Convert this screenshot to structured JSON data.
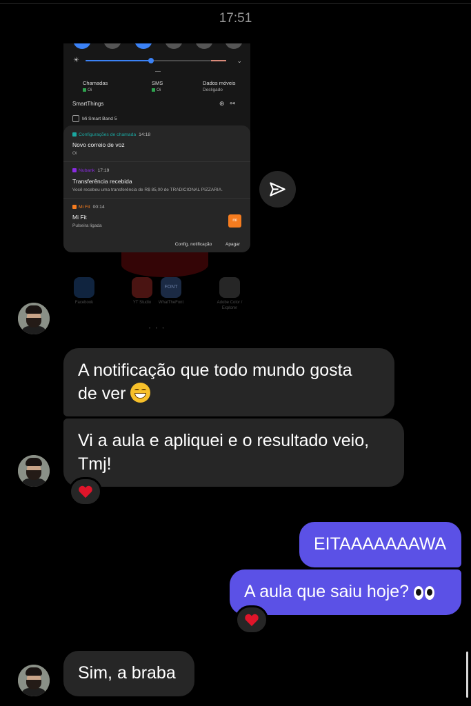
{
  "header": {
    "time": "17:51"
  },
  "shared_screenshot": {
    "quick_settings": {
      "sims": [
        {
          "label": "Chamadas",
          "value": "Oi"
        },
        {
          "label": "SMS",
          "value": "Oi"
        },
        {
          "label": "Dados móveis",
          "value": "Desligado"
        }
      ],
      "smartthings_label": "SmartThings",
      "device_label": "Mi Smart Band 5",
      "brightness_level": 0.52
    },
    "notifications": [
      {
        "app": "Configurações de chamada",
        "time": "14:18",
        "title": "Novo correio de voz",
        "body": "Oi",
        "icon_color": "#1aa7a0"
      },
      {
        "app": "Nubank",
        "time": "17:19",
        "title": "Transferência recebida",
        "body": "Você recebeu uma transferência de R$ 85,00 de TRADICIONAL PIZZARIA.",
        "icon_color": "#8a2be2"
      },
      {
        "app": "Mi Fit",
        "time": "00:14",
        "title": "Mi Fit",
        "body": "Pulseira ligada",
        "icon_color": "#f57c1f",
        "thumb_text": "mi"
      }
    ],
    "notification_actions": {
      "settings": "Config. notificação",
      "clear": "Apagar"
    },
    "home_apps": [
      {
        "label": "Facebook",
        "color": "#1877f2"
      },
      {
        "label": "YT Studio",
        "color": "#e5271d"
      },
      {
        "label": "WhatTheFont",
        "color": "#2c4b8a",
        "icon_text": "FONT"
      },
      {
        "label": "Adobe Color / Explorer",
        "color": "#3a3a3a"
      }
    ]
  },
  "messages": [
    {
      "from": "them",
      "text": "A notificação que todo mundo gosta",
      "text2": "de ver",
      "emoji": "grinning-face"
    },
    {
      "from": "them",
      "text": "Vi a aula e apliquei e o resultado veio,",
      "text2": "Tmj!",
      "reaction": "heart"
    },
    {
      "from": "me",
      "text": "EITAAAAAAAWA"
    },
    {
      "from": "me",
      "text": "A aula que saiu hoje?",
      "emoji": "eyes",
      "reaction": "heart"
    },
    {
      "from": "them",
      "text": "Sim, a braba"
    }
  ],
  "colors": {
    "background": "#000000",
    "incoming_bubble": "#262626",
    "outgoing_bubble": "#5b51e6",
    "reaction_heart": "#e0152a"
  }
}
